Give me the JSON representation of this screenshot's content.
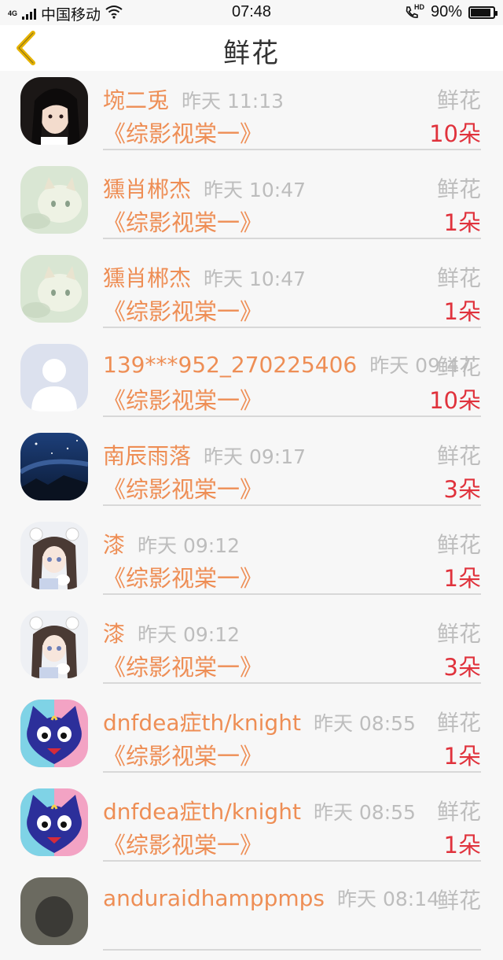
{
  "status_bar": {
    "network_tag": "4G",
    "carrier": "中国移动",
    "time": "07:48",
    "call_tag": "HD",
    "battery": "90%",
    "battery_level": 0.9
  },
  "header": {
    "title": "鲜花"
  },
  "rows": [
    {
      "name": "埦二兎",
      "time": "昨天 11:13",
      "label": "鲜花",
      "book": "《综影视棠一》",
      "count": "10朵",
      "avatar": "anime-dark-hair"
    },
    {
      "name": "獯肖郴杰",
      "time": "昨天 10:47",
      "label": "鲜花",
      "book": "《综影视棠一》",
      "count": "1朵",
      "avatar": "pale-cat"
    },
    {
      "name": "獯肖郴杰",
      "time": "昨天 10:47",
      "label": "鲜花",
      "book": "《综影视棠一》",
      "count": "1朵",
      "avatar": "pale-cat"
    },
    {
      "name": "139***952_270225406",
      "time": "昨天 09:47",
      "label": "鲜花",
      "book": "《综影视棠一》",
      "count": "10朵",
      "avatar": "default-person"
    },
    {
      "name": "南辰雨落",
      "time": "昨天 09:17",
      "label": "鲜花",
      "book": "《综影视棠一》",
      "count": "3朵",
      "avatar": "night-sky"
    },
    {
      "name": "漆",
      "time": "昨天 09:12",
      "label": "鲜花",
      "book": "《综影视棠一》",
      "count": "1朵",
      "avatar": "anime-girl"
    },
    {
      "name": "漆",
      "time": "昨天 09:12",
      "label": "鲜花",
      "book": "《综影视棠一》",
      "count": "3朵",
      "avatar": "anime-girl"
    },
    {
      "name": "dnfdea症th/knight",
      "time": "昨天 08:55",
      "label": "鲜花",
      "book": "《综影视棠一》",
      "count": "1朵",
      "avatar": "blue-cat"
    },
    {
      "name": "dnfdea症th/knight",
      "time": "昨天 08:55",
      "label": "鲜花",
      "book": "《综影视棠一》",
      "count": "1朵",
      "avatar": "blue-cat"
    },
    {
      "name": "anduraidhamppmps",
      "time": "昨天 08:14",
      "label": "鲜花",
      "book": "",
      "count": "",
      "avatar": "partial"
    }
  ],
  "colors": {
    "name": "#ee8e55",
    "time": "#bdbdbd",
    "count": "#e0323c",
    "back_arrow": "#e6b300"
  }
}
